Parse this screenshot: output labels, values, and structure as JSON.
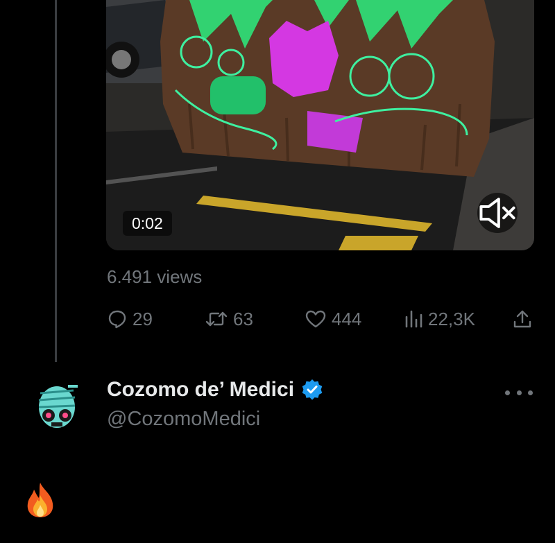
{
  "video": {
    "timestamp": "0:02",
    "muted": true,
    "icons": {
      "mute": "speaker-muted-icon"
    }
  },
  "tweet": {
    "views": "6.491 views",
    "stats": {
      "replies": "29",
      "reposts": "63",
      "likes": "444",
      "impressions": "22,3K"
    },
    "icons": {
      "replies": "reply-bubble-icon",
      "reposts": "repost-arrows-icon",
      "likes": "heart-icon",
      "impressions": "bar-chart-icon",
      "share": "share-upload-icon"
    }
  },
  "reply": {
    "display_name": "Cozomo de’ Medici",
    "handle": "@CozomoMedici",
    "verified": true,
    "body_emoji": "🔥",
    "icons": {
      "verified": "verified-badge-icon",
      "more": "more-dots-icon",
      "avatar": "zombie-avatar"
    }
  },
  "colors": {
    "background": "#000000",
    "text": "#e7e9ea",
    "muted_text": "#71767b",
    "verified_blue": "#1d9bf0",
    "thread_line": "#3a3d41"
  }
}
